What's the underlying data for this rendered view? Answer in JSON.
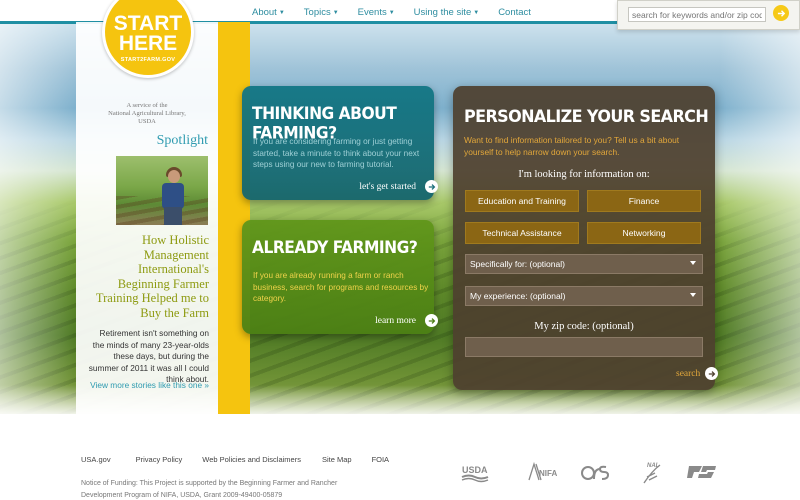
{
  "nav": {
    "items": [
      {
        "label": "About",
        "has_menu": true
      },
      {
        "label": "Topics",
        "has_menu": true
      },
      {
        "label": "Events",
        "has_menu": true
      },
      {
        "label": "Using the site",
        "has_menu": true
      },
      {
        "label": "Contact",
        "has_menu": false
      }
    ],
    "search_placeholder": "search for keywords and/or zip code"
  },
  "logo": {
    "line1": "START",
    "line2": "HERE",
    "sub": "START2FARM.GOV"
  },
  "sidebar": {
    "service_note_line1": "A service of the",
    "service_note_line2": "National Agricultural Library,",
    "service_note_line3": "USDA",
    "spotlight_title": "Spotlight",
    "headline": "How Holistic Management International's Beginning Farmer Training Helped me to Buy the Farm",
    "body": "Retirement isn't something on the minds of many 23-year-olds these days, but during the summer of 2011 it was all I could think about.",
    "more_link": "View more stories like this one »"
  },
  "cards": {
    "thinking": {
      "title": "THINKING ABOUT FARMING?",
      "text": "If you are considering farming or just getting started, take a minute to think about your next steps using our new to farming tutorial.",
      "link": "let's get started"
    },
    "already": {
      "title": "ALREADY FARMING?",
      "text": "If you are already running a farm or ranch business, search for programs and resources by category.",
      "link": "learn more"
    }
  },
  "personalize": {
    "title": "PERSONALIZE YOUR SEARCH",
    "intro": "Want to find information tailored to you? Tell us a bit about yourself to help narrow down your search.",
    "looking_label": "I'm looking for information on:",
    "options": [
      "Education and Training",
      "Finance",
      "Technical Assistance",
      "Networking"
    ],
    "specifically_for": "Specifically for: (optional)",
    "experience": "My experience: (optional)",
    "zip_label": "My zip code: (optional)",
    "zip_value": "",
    "search_link": "search"
  },
  "footer": {
    "links": [
      "USA.gov",
      "Privacy Policy",
      "Web Policies and Disclaimers",
      "Site Map",
      "FOIA"
    ],
    "funding_line1": "Notice of Funding: This Project is supported by the Beginning Farmer and Rancher",
    "funding_line2": "Development Program of NIFA, USDA, Grant 2009-49400-05879",
    "agencies": [
      "USDA",
      "NIFA",
      "ARS",
      "NAL",
      "FSA"
    ]
  },
  "colors": {
    "accent_teal": "#1f8fa3",
    "brand_yellow": "#f5c40f",
    "headline_olive": "#8e9b12",
    "option_gold": "#8b6614",
    "panel_brown": "#4e402e",
    "intro_orange": "#e2a73b"
  }
}
